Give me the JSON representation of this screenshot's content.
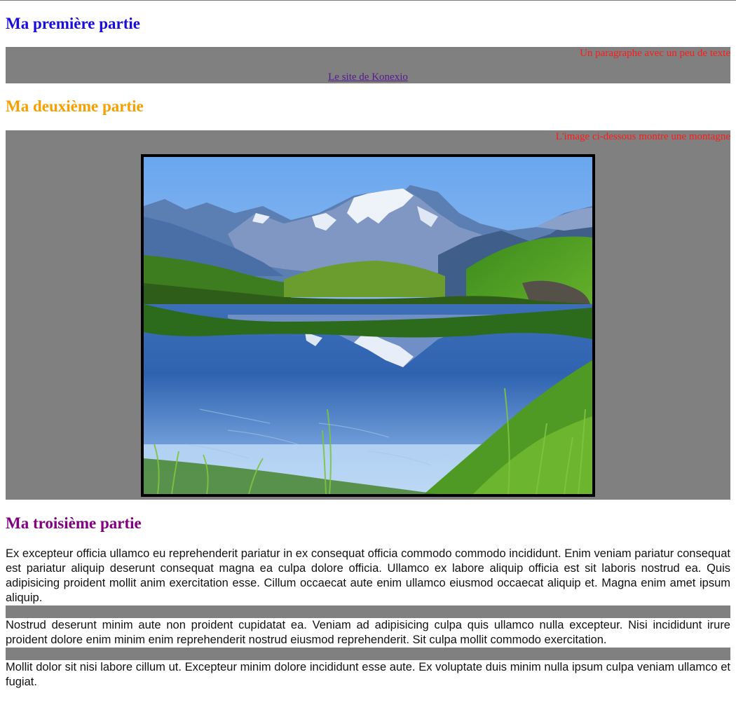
{
  "sections": {
    "part1": {
      "title": "Ma première partie",
      "paragraph": "Un paragraphe avec un peu de texte",
      "link_text": "Le site de Konexio"
    },
    "part2": {
      "title": "Ma deuxième partie",
      "caption": "L'image ci-dessous montre une montagne"
    },
    "part3": {
      "title": "Ma troisième partie",
      "paragraphs": [
        "Ex excepteur officia ullamco eu reprehenderit pariatur in ex consequat officia commodo commodo incididunt. Enim veniam pariatur consequat est pariatur aliquip deserunt consequat magna ea culpa dolore officia. Ullamco ex labore aliquip officia est sit laboris nostrud ea. Quis adipisicing proident mollit anim exercitation esse. Cillum occaecat aute enim ullamco eiusmod occaecat aliquip et. Magna enim amet ipsum aliquip.",
        "Nostrud deserunt minim aute non proident cupidatat ea. Veniam ad adipisicing culpa quis ullamco nulla excepteur. Nisi incididunt irure proident dolore enim minim enim reprehenderit nostrud eiusmod reprehenderit. Sit culpa mollit commodo exercitation.",
        "Mollit dolor sit nisi labore cillum ut. Excepteur minim dolore incididunt esse aute. Ex voluptate duis minim nulla ipsum culpa veniam ullamco et fugiat."
      ]
    }
  },
  "colors": {
    "title1": "#1a0ddb",
    "title2": "#f5a000",
    "title3": "#800080",
    "note": "#ff1a1a",
    "box": "#808080",
    "link": "#551a8b"
  }
}
